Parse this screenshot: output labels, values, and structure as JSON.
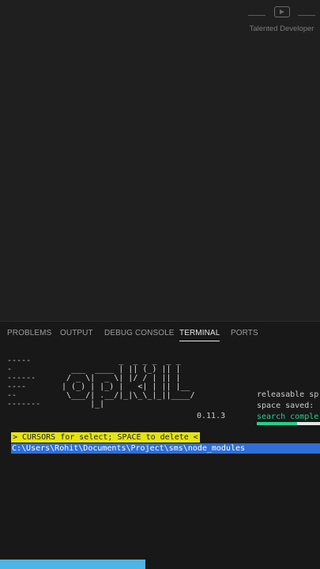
{
  "watermark": {
    "label": "Talented Developer"
  },
  "panel": {
    "tabs": [
      {
        "label": "PROBLEMS"
      },
      {
        "label": "OUTPUT"
      },
      {
        "label": "DEBUG CONSOLE"
      },
      {
        "label": "TERMINAL"
      },
      {
        "label": "PORTS"
      }
    ],
    "active_tab": "TERMINAL"
  },
  "terminal": {
    "dashes": "-----\n-\n------\n----\n--\n-------",
    "logo": "             _  _ _ _  _ _\n   ___  ____ | || (_) || |\n  / _ \\|  _ \\| |/ / | || |\n | (_) | |_) |   <| | || |__\n  \\___/| .__/|_|\\_\\_|_||____/\n       |_|",
    "version": "0.11.3",
    "stats": {
      "releasable": "releasable sp",
      "space_saved": "space saved:",
      "status": "search comple"
    },
    "search_progress": 0.64,
    "hint": "> CURSORS for select; SPACE to delete <",
    "selected_path": "C:\\Users\\Rohit\\Documents\\Project\\sms\\node_modules"
  }
}
